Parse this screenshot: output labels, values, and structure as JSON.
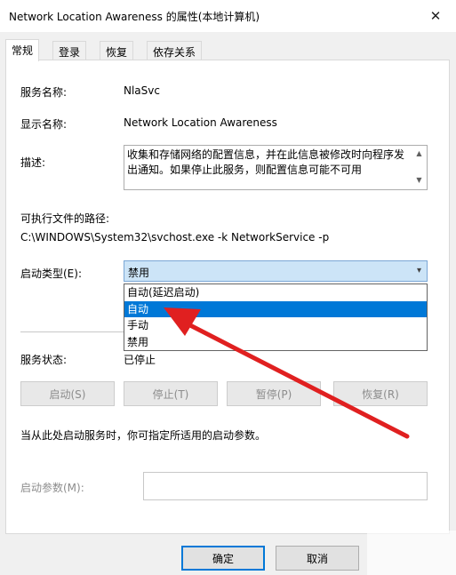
{
  "window": {
    "title": "Network Location Awareness 的属性(本地计算机)",
    "close_glyph": "✕"
  },
  "tabs": [
    {
      "label": "常规",
      "active": true
    },
    {
      "label": "登录"
    },
    {
      "label": "恢复"
    },
    {
      "label": "依存关系"
    }
  ],
  "fields": {
    "service_name_label": "服务名称:",
    "service_name": "NlaSvc",
    "display_name_label": "显示名称:",
    "display_name": "Network Location Awareness",
    "description_label": "描述:",
    "description": "收集和存储网络的配置信息，并在此信息被修改时向程序发出通知。如果停止此服务，则配置信息可能不可用",
    "exe_path_label": "可执行文件的路径:",
    "exe_path": "C:\\WINDOWS\\System32\\svchost.exe -k NetworkService -p",
    "startup_type_label": "启动类型(E):",
    "startup_type_value": "禁用",
    "startup_options": [
      "自动(延迟启动)",
      "自动",
      "手动",
      "禁用"
    ],
    "highlighted_option": "自动",
    "service_status_label": "服务状态:",
    "service_status": "已停止"
  },
  "buttons": {
    "start": "启动(S)",
    "stop": "停止(T)",
    "pause": "暂停(P)",
    "resume": "恢复(R)"
  },
  "hint": "当从此处启动服务时，你可指定所适用的启动参数。",
  "start_params_label": "启动参数(M):",
  "start_params_value": "",
  "footer": {
    "ok": "确定",
    "cancel": "取消"
  },
  "colors": {
    "selection": "#0078d7",
    "annotation_arrow": "#e02020"
  }
}
